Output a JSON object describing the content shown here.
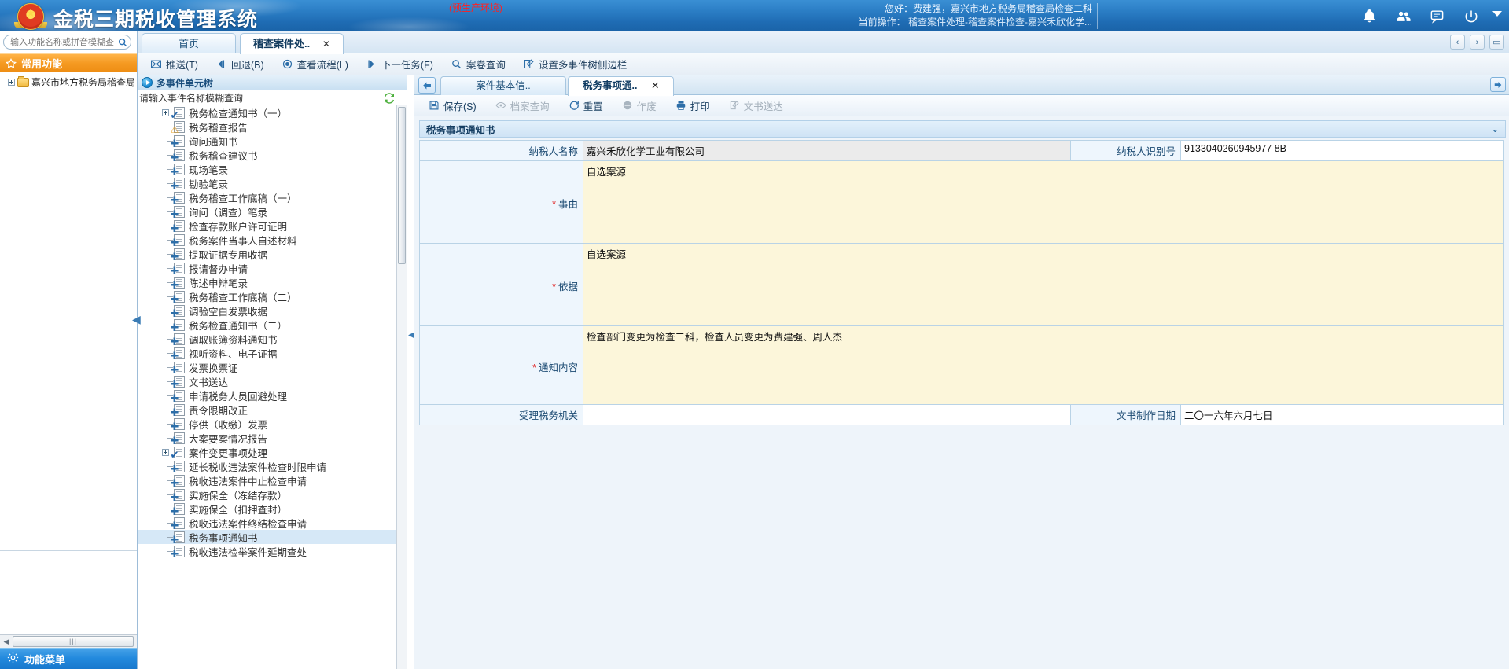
{
  "banner": {
    "system_title": "金税三期税收管理系统",
    "env_tag": "(预生产环境)",
    "greeting": "您好：费建强，嘉兴市地方税务局稽查局检查二科",
    "current_op": "当前操作： 稽查案件处理-稽查案件检查-嘉兴禾欣化学...",
    "icons": [
      "bell-icon",
      "users-icon",
      "message-icon",
      "power-icon",
      "caret-down-icon"
    ]
  },
  "sidebar": {
    "search_placeholder": "输入功能名称或拼音模糊查",
    "fav_title": "常用功能",
    "tree_root": "嘉兴市地方税务局稽查局",
    "menu_button": "功能菜单"
  },
  "tabs": {
    "items": [
      {
        "label": "首页",
        "active": false,
        "closable": false
      },
      {
        "label": "稽查案件处..",
        "active": true,
        "closable": true
      }
    ],
    "close_glyph": "✕",
    "nav": [
      "prev-icon",
      "next-icon",
      "window-icon"
    ]
  },
  "toolbar": {
    "buttons": [
      {
        "label": "推送(T)",
        "icon": "push-icon",
        "accel": "T"
      },
      {
        "label": "回退(B)",
        "icon": "back-icon",
        "accel": "B"
      },
      {
        "label": "查看流程(L)",
        "icon": "flow-icon",
        "accel": "L"
      },
      {
        "label": "下一任务(F)",
        "icon": "next-task-icon",
        "accel": "F"
      },
      {
        "label": "案卷查询",
        "icon": "search-icon",
        "accel": ""
      },
      {
        "label": "设置多事件树侧边栏",
        "icon": "edit-icon",
        "accel": ""
      }
    ]
  },
  "tree_panel": {
    "header": "多事件单元树",
    "search_placeholder": "请输入事件名称模糊查询",
    "refresh_icon": "refresh-icon",
    "items": [
      {
        "label": "税务检查通知书（一）",
        "badge": "check",
        "expandable": true,
        "selected": false
      },
      {
        "label": "税务稽查报告",
        "badge": "warn",
        "expandable": false,
        "selected": false
      },
      {
        "label": "询问通知书",
        "badge": "plus",
        "expandable": false,
        "selected": false
      },
      {
        "label": "税务稽查建议书",
        "badge": "plus",
        "expandable": false,
        "selected": false
      },
      {
        "label": "现场笔录",
        "badge": "plus",
        "expandable": false,
        "selected": false
      },
      {
        "label": "勘验笔录",
        "badge": "plus",
        "expandable": false,
        "selected": false
      },
      {
        "label": "税务稽查工作底稿（一）",
        "badge": "plus",
        "expandable": false,
        "selected": false
      },
      {
        "label": "询问（调查）笔录",
        "badge": "plus",
        "expandable": false,
        "selected": false
      },
      {
        "label": "检查存款账户许可证明",
        "badge": "plus",
        "expandable": false,
        "selected": false
      },
      {
        "label": "税务案件当事人自述材料",
        "badge": "plus",
        "expandable": false,
        "selected": false
      },
      {
        "label": "提取证据专用收据",
        "badge": "plus",
        "expandable": false,
        "selected": false
      },
      {
        "label": "报请督办申请",
        "badge": "plus",
        "expandable": false,
        "selected": false
      },
      {
        "label": "陈述申辩笔录",
        "badge": "plus",
        "expandable": false,
        "selected": false
      },
      {
        "label": "税务稽查工作底稿（二）",
        "badge": "plus",
        "expandable": false,
        "selected": false
      },
      {
        "label": "调验空白发票收据",
        "badge": "plus",
        "expandable": false,
        "selected": false
      },
      {
        "label": "税务检查通知书（二）",
        "badge": "plus",
        "expandable": false,
        "selected": false
      },
      {
        "label": "调取账簿资料通知书",
        "badge": "plus",
        "expandable": false,
        "selected": false
      },
      {
        "label": "视听资料、电子证据",
        "badge": "plus",
        "expandable": false,
        "selected": false
      },
      {
        "label": "发票换票证",
        "badge": "plus",
        "expandable": false,
        "selected": false
      },
      {
        "label": "文书送达",
        "badge": "plus",
        "expandable": false,
        "selected": false
      },
      {
        "label": "申请税务人员回避处理",
        "badge": "plus",
        "expandable": false,
        "selected": false
      },
      {
        "label": "责令限期改正",
        "badge": "plus",
        "expandable": false,
        "selected": false
      },
      {
        "label": "停供（收缴）发票",
        "badge": "plus",
        "expandable": false,
        "selected": false
      },
      {
        "label": "大案要案情况报告",
        "badge": "plus",
        "expandable": false,
        "selected": false
      },
      {
        "label": "案件变更事项处理",
        "badge": "check",
        "expandable": true,
        "selected": false
      },
      {
        "label": "延长税收违法案件检查时限申请",
        "badge": "plus",
        "expandable": false,
        "selected": false
      },
      {
        "label": "税收违法案件中止检查申请",
        "badge": "plus",
        "expandable": false,
        "selected": false
      },
      {
        "label": "实施保全（冻结存款）",
        "badge": "plus",
        "expandable": false,
        "selected": false
      },
      {
        "label": "实施保全（扣押查封）",
        "badge": "plus",
        "expandable": false,
        "selected": false
      },
      {
        "label": "税收违法案件终结检查申请",
        "badge": "plus",
        "expandable": false,
        "selected": false
      },
      {
        "label": "税务事项通知书",
        "badge": "plus",
        "expandable": false,
        "selected": true
      },
      {
        "label": "税收违法检举案件延期查处",
        "badge": "plus",
        "expandable": false,
        "selected": false
      }
    ]
  },
  "content": {
    "inner_tabs": [
      {
        "label": "案件基本信..",
        "active": false,
        "closable": false
      },
      {
        "label": "税务事项通..",
        "active": true,
        "closable": true
      }
    ],
    "close_glyph": "✕",
    "form_toolbar": [
      {
        "label": "保存(S)",
        "icon": "save-icon",
        "disabled": false
      },
      {
        "label": "档案查询",
        "icon": "archive-icon",
        "disabled": true
      },
      {
        "label": "重置",
        "icon": "reset-icon",
        "disabled": false
      },
      {
        "label": "作废",
        "icon": "void-icon",
        "disabled": true
      },
      {
        "label": "打印",
        "icon": "print-icon",
        "disabled": false
      },
      {
        "label": "文书送达",
        "icon": "deliver-icon",
        "disabled": true
      }
    ],
    "section_title": "税务事项通知书",
    "section_chevron": "chevron-down-icon",
    "form": {
      "taxpayer_name_label": "纳税人名称",
      "taxpayer_name_value": "嘉兴禾欣化学工业有限公司",
      "taxpayer_id_label": "纳税人识别号",
      "taxpayer_id_value": "9133040260945977 8B",
      "reason_label": "事由",
      "reason_value": "自选案源",
      "basis_label": "依据",
      "basis_value": "自选案源",
      "notice_label": "通知内容",
      "notice_value": "检查部门变更为检查二科，检查人员变更为费建强、周人杰",
      "authority_label": "受理税务机关",
      "authority_value": "",
      "doc_date_label": "文书制作日期",
      "doc_date_value": "二〇一六年六月七日",
      "required_marker": "*"
    }
  }
}
